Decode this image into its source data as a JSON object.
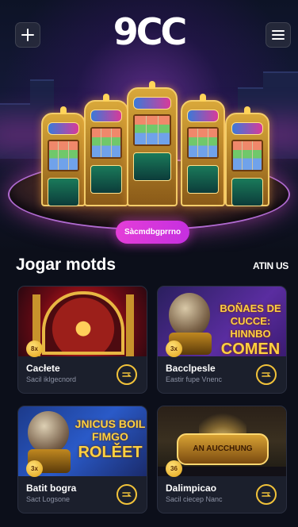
{
  "header": {
    "logo": "9CC",
    "add_icon": "plus-icon",
    "menu_icon": "hamburger-menu-icon"
  },
  "hero": {
    "cta_label": "Sàcmdbgprrno"
  },
  "section": {
    "title": "Jogar motds",
    "link": "ATIN US"
  },
  "cards": [
    {
      "title": "Cacłete",
      "subtitle": "Sacil iklgecnord",
      "badge": "8x",
      "art_text": [
        "",
        ""
      ]
    },
    {
      "title": "Bacclpesle",
      "subtitle": "Eastir fupe Vnenc",
      "badge": "3x",
      "art_text": [
        "BOÑAES DE CUCCE: HINNBO",
        "COMEN"
      ]
    },
    {
      "title": "Batit bogra",
      "subtitle": "Sact Logsone",
      "badge": "3x",
      "art_text": [
        "JNICUS BOIL FIMGO",
        "ROLĚET"
      ]
    },
    {
      "title": "Dalimpicao",
      "subtitle": "Sacil ciecep Nanc",
      "badge": "36",
      "art_text": [
        "AN AUCCHUNG",
        ""
      ]
    }
  ],
  "colors": {
    "background": "#0c0f1a",
    "cta_pink": "#e43ed8",
    "accent_gold": "#f2c33a",
    "card_bg": "#1b1f2c"
  }
}
